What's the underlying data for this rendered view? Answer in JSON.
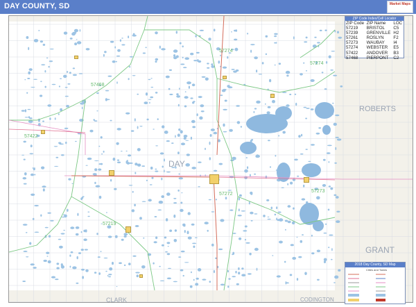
{
  "header": {
    "title": "DAY COUNTY, SD",
    "logo_text": "Market Maps"
  },
  "counties": {
    "center": "DAY",
    "east": "ROBERTS",
    "southeast": "GRANT",
    "south_center": "CLARK",
    "south_east": "CODINGTON"
  },
  "zip_labels": [
    "57274",
    "57468",
    "57422",
    "57273",
    "57272",
    "57274",
    "57219"
  ],
  "zip_legend": {
    "title": "ZIP Code Index/Cell Locator",
    "columns": [
      "ZIP Code",
      "ZIP Name",
      "LOC"
    ],
    "rows": [
      [
        "57219",
        "BRISTOL",
        "C5"
      ],
      [
        "57239",
        "GRENVILLE",
        "H2"
      ],
      [
        "57261",
        "ROSLYN",
        "F2"
      ],
      [
        "57273",
        "WAUBAY",
        "I4"
      ],
      [
        "57274",
        "WEBSTER",
        "E5"
      ],
      [
        "57422",
        "ANDOVER",
        "B3"
      ],
      [
        "57468",
        "PIERPONT",
        "C2"
      ]
    ]
  },
  "map_legend": {
    "title": "2018 Day County, SD Map",
    "subtitle": "Cities and Towns"
  },
  "colors": {
    "title_bar": "#5a7fc9",
    "water": "#9cc3e4",
    "zip_boundary": "#63b86b",
    "highway": "#d06a5a",
    "county_line": "#e08cc0",
    "city": "#f2d06b"
  }
}
